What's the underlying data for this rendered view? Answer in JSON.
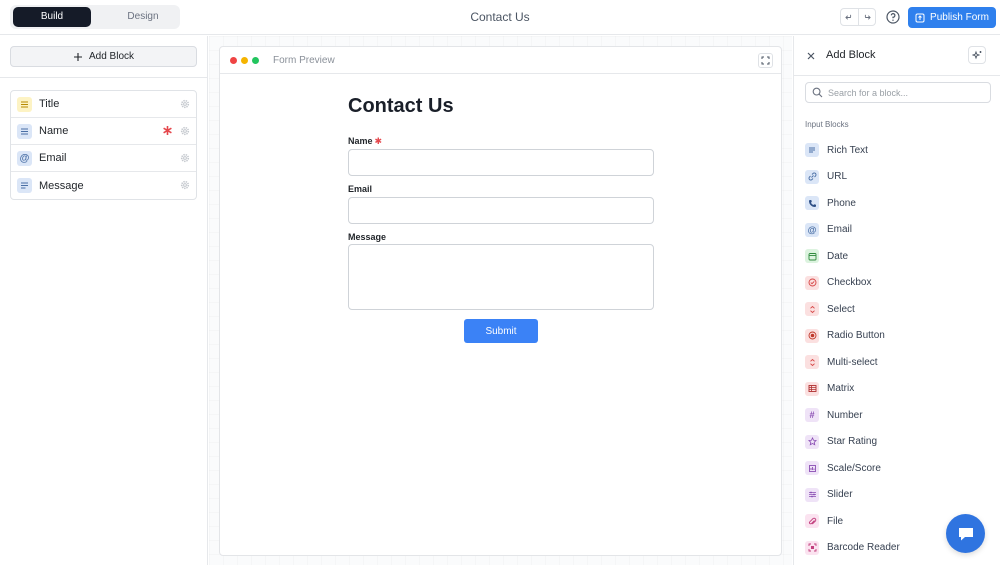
{
  "topbar": {
    "tabs": [
      {
        "label": "Build",
        "active": true
      },
      {
        "label": "Design",
        "active": false
      }
    ],
    "title": "Contact Us",
    "publish_label": "Publish Form"
  },
  "left": {
    "add_block_label": "Add Block",
    "blocks": [
      {
        "label": "Title",
        "icon": "title-icon",
        "icon_bg": "#fdf3c4",
        "icon_color": "#b88a00",
        "required": false
      },
      {
        "label": "Name",
        "icon": "short-text-icon",
        "icon_bg": "#dbe6f7",
        "icon_color": "#4a6fa5",
        "required": true
      },
      {
        "label": "Email",
        "icon": "at-icon",
        "icon_bg": "#dbe6f7",
        "icon_color": "#4a6fa5",
        "required": false
      },
      {
        "label": "Message",
        "icon": "long-text-icon",
        "icon_bg": "#dbe6f7",
        "icon_color": "#4a6fa5",
        "required": false
      }
    ]
  },
  "preview": {
    "bar_label": "Form Preview",
    "form_title": "Contact Us",
    "fields": [
      {
        "label": "Name",
        "required": true,
        "value": ""
      },
      {
        "label": "Email",
        "required": false,
        "value": ""
      },
      {
        "label": "Message",
        "required": false,
        "value": ""
      }
    ],
    "submit_label": "Submit"
  },
  "right": {
    "title": "Add Block",
    "search_placeholder": "Search for a block...",
    "section_label": "Input Blocks",
    "items": [
      {
        "label": "Rich Text",
        "icon": "rich-text-icon",
        "bg": "#dbe6f7",
        "fg": "#4a6fa5"
      },
      {
        "label": "URL",
        "icon": "link-icon",
        "bg": "#dbe6f7",
        "fg": "#4a6fa5"
      },
      {
        "label": "Phone",
        "icon": "phone-icon",
        "bg": "#dbe6f7",
        "fg": "#2e4f86"
      },
      {
        "label": "Email",
        "icon": "at-icon",
        "bg": "#dbe6f7",
        "fg": "#4a6fa5"
      },
      {
        "label": "Date",
        "icon": "calendar-icon",
        "bg": "#dcf3df",
        "fg": "#2f8a3d"
      },
      {
        "label": "Checkbox",
        "icon": "check-circle-icon",
        "bg": "#fbe0e0",
        "fg": "#d64545"
      },
      {
        "label": "Select",
        "icon": "select-icon",
        "bg": "#fbe0e0",
        "fg": "#d64545"
      },
      {
        "label": "Radio Button",
        "icon": "radio-icon",
        "bg": "#fbe0e0",
        "fg": "#c0392b"
      },
      {
        "label": "Multi-select",
        "icon": "multi-select-icon",
        "bg": "#fbe0e0",
        "fg": "#d64545"
      },
      {
        "label": "Matrix",
        "icon": "table-icon",
        "bg": "#fbe0e0",
        "fg": "#b03030"
      },
      {
        "label": "Number",
        "icon": "hash-icon",
        "bg": "#efe3f7",
        "fg": "#8a4db3"
      },
      {
        "label": "Star Rating",
        "icon": "star-icon",
        "bg": "#efe3f7",
        "fg": "#8a4db3"
      },
      {
        "label": "Scale/Score",
        "icon": "scale-icon",
        "bg": "#efe3f7",
        "fg": "#8a4db3"
      },
      {
        "label": "Slider",
        "icon": "slider-icon",
        "bg": "#efe3f7",
        "fg": "#8a4db3"
      },
      {
        "label": "File",
        "icon": "paperclip-icon",
        "bg": "#fbe3f0",
        "fg": "#c2407e"
      },
      {
        "label": "Barcode Reader",
        "icon": "barcode-icon",
        "bg": "#fbe3f0",
        "fg": "#c2407e"
      }
    ]
  },
  "colors": {
    "accent": "#2f80ed",
    "dark": "#151b28",
    "required": "#e5484d"
  }
}
